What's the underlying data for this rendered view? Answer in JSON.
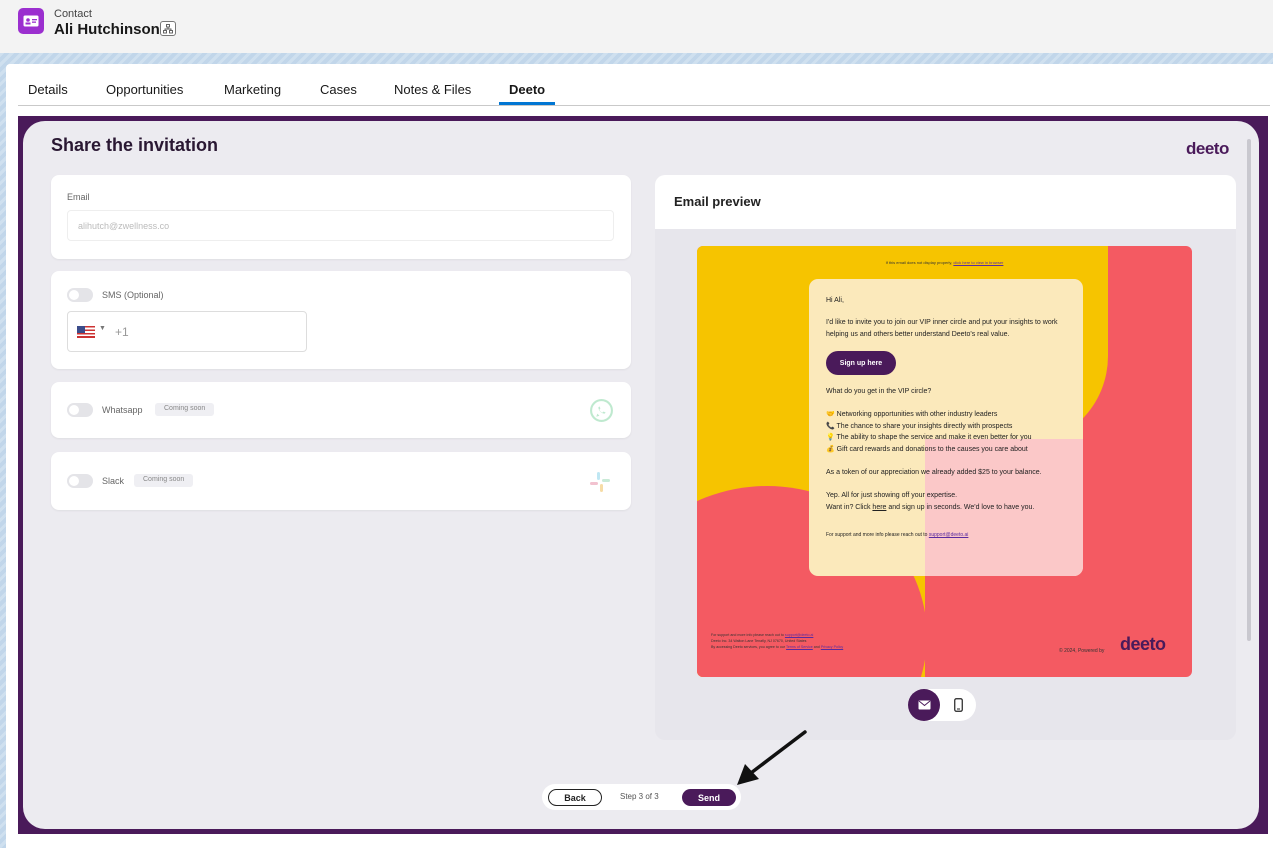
{
  "header": {
    "object_type": "Contact",
    "record_name": "Ali Hutchinson"
  },
  "tabs": [
    {
      "label": "Details"
    },
    {
      "label": "Opportunities"
    },
    {
      "label": "Marketing"
    },
    {
      "label": "Cases"
    },
    {
      "label": "Notes & Files"
    },
    {
      "label": "Deeto",
      "active": true
    }
  ],
  "deeto": {
    "title": "Share the invitation",
    "logo": "deeto",
    "email": {
      "label": "Email",
      "placeholder": "alihutch@zwellness.co"
    },
    "sms": {
      "label": "SMS (Optional)",
      "country": "US",
      "dial_code": "+1"
    },
    "whatsapp": {
      "label": "Whatsapp",
      "badge": "Coming soon"
    },
    "slack": {
      "label": "Slack",
      "badge": "Coming soon"
    },
    "preview": {
      "title": "Email preview",
      "top_note": "If this email does not display properly, ",
      "top_link": "click here to view in browser",
      "greeting": "Hi Ali,",
      "intro": "I'd like to invite you to join our VIP inner circle and put your insights to work helping us and others better understand Deeto's real value.",
      "cta": "Sign up here",
      "question": "What do you get in the VIP circle?",
      "benefits": [
        "🤝 Networking opportunities with other industry leaders",
        "📞 The chance to share your insights directly with prospects",
        "💡 The ability to shape the service and make it even better for you",
        "💰 Gift card rewards and donations to the causes you care about"
      ],
      "token": "As a token of our appreciation we already added $25 to your balance.",
      "yep": "Yep. All for just showing off your expertise.",
      "want_in_pre": "Want in? Click ",
      "want_in_link": "here",
      "want_in_post": " and sign up in seconds. We'd love to have you.",
      "support_pre": "For support and more info please reach out to ",
      "support_link": "support@deeto.ai",
      "footer_line1_pre": "For support and more info please reach out to ",
      "footer_line1_link": "support@deeto.ai",
      "footer_line2": "Deeto Inc. 34 Walton Lane Tenafly, NJ 07670, United States",
      "footer_line3_pre": "By accessing Deeto services, you agree to our ",
      "footer_line3_link1": "Terms of Service",
      "footer_line3_mid": " and ",
      "footer_line3_link2": "Privacy Policy",
      "powered": "© 2024, Powered by",
      "footer_logo": "deeto"
    },
    "nav": {
      "back": "Back",
      "step": "Step 3 of 3",
      "send": "Send"
    }
  },
  "colors": {
    "brand_purple": "#4a1a5a",
    "yellow": "#f6c400",
    "coral": "#f45a62",
    "contact_icon": "#9b2fcf",
    "tab_active": "#0176d3"
  },
  "icons": [
    "contact-card-icon",
    "hierarchy-icon",
    "whatsapp-icon",
    "slack-icon",
    "mail-icon",
    "mobile-icon",
    "arrow-icon"
  ]
}
